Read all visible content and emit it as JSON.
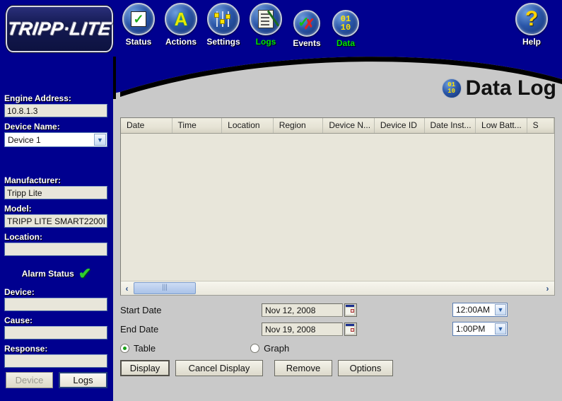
{
  "app": {
    "brand": "TRIPP·LITE",
    "accent_blue": "#00008f",
    "accent_green": "#00e400",
    "page_bg": "#c9c9c9"
  },
  "toolbar": {
    "items": [
      {
        "label": "Status",
        "icon": "status-check-icon",
        "active": false
      },
      {
        "label": "Actions",
        "icon": "actions-a-icon",
        "active": false
      },
      {
        "label": "Settings",
        "icon": "settings-sliders-icon",
        "active": false
      },
      {
        "label": "Logs",
        "icon": "logs-document-icon",
        "active": true
      },
      {
        "label": "Events",
        "icon": "events-checkx-icon",
        "active": false
      },
      {
        "label": "Data",
        "icon": "data-binary-icon",
        "active": true
      }
    ],
    "help": {
      "label": "Help",
      "icon": "help-question-icon"
    }
  },
  "sidebar": {
    "engine_address_label": "Engine Address:",
    "engine_address_value": "10.8.1.3",
    "device_name_label": "Device Name:",
    "device_name_value": "Device 1",
    "manufacturer_label": "Manufacturer:",
    "manufacturer_value": "Tripp Lite",
    "model_label": "Model:",
    "model_value": "TRIPP LITE SMART2200I",
    "location_label": "Location:",
    "location_value": "",
    "alarm_status_label": "Alarm Status",
    "alarm_status_icon": "green-check-icon",
    "device_label": "Device:",
    "device_value": "",
    "cause_label": "Cause:",
    "cause_value": "",
    "response_label": "Response:",
    "response_value": "",
    "device_button": "Device",
    "logs_button": "Logs"
  },
  "main": {
    "title": "Data Log",
    "title_icon": "data-binary-icon",
    "table": {
      "columns": [
        {
          "label": "Date",
          "width": 76
        },
        {
          "label": "Time",
          "width": 74
        },
        {
          "label": "Location",
          "width": 76
        },
        {
          "label": "Region",
          "width": 74
        },
        {
          "label": "Device N...",
          "width": 76
        },
        {
          "label": "Device ID",
          "width": 74
        },
        {
          "label": "Date Inst...",
          "width": 76
        },
        {
          "label": "Low Batt...",
          "width": 76
        },
        {
          "label": "S",
          "width": 40
        }
      ],
      "rows": []
    },
    "scrollbar": {
      "left_arrow": "‹",
      "right_arrow": "›"
    },
    "form": {
      "start_date_label": "Start Date",
      "start_date_value": "Nov 12, 2008",
      "end_date_label": "End Date",
      "end_date_value": "Nov 19, 2008",
      "start_time_value": "12:00AM",
      "end_time_value": "1:00PM",
      "calendar_icon": "calendar-icon",
      "table_radio_label": "Table",
      "graph_radio_label": "Graph",
      "table_radio_selected": true,
      "graph_radio_selected": false,
      "buttons": [
        {
          "label": "Display"
        },
        {
          "label": "Cancel Display"
        },
        {
          "label": "Remove"
        },
        {
          "label": "Options"
        }
      ]
    }
  }
}
